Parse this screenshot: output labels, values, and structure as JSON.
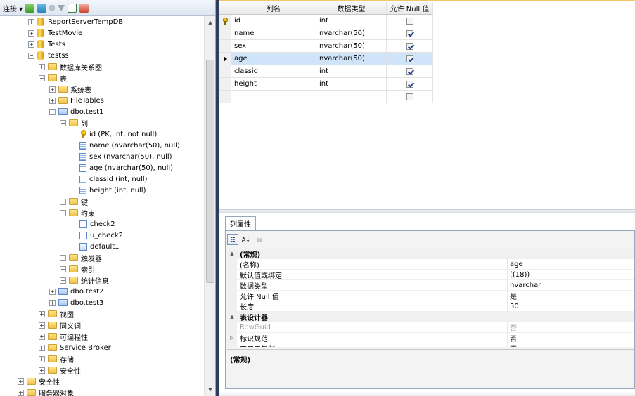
{
  "object_explorer": {
    "toolbar": {
      "connect_label": "连接 ▾"
    },
    "tree": [
      {
        "label": "ReportServerTempDB",
        "icon": "database-icon",
        "exp": "+",
        "indent": 0
      },
      {
        "label": "TestMovie",
        "icon": "database-icon",
        "exp": "+",
        "indent": 0
      },
      {
        "label": "Tests",
        "icon": "database-icon",
        "exp": "+",
        "indent": 0
      },
      {
        "label": "testss",
        "icon": "database-icon",
        "exp": "−",
        "indent": 0
      },
      {
        "label": "数据库关系图",
        "icon": "folder-icon",
        "exp": "+",
        "indent": 1
      },
      {
        "label": "表",
        "icon": "folder-icon",
        "exp": "−",
        "indent": 1
      },
      {
        "label": "系统表",
        "icon": "folder-icon",
        "exp": "+",
        "indent": 2
      },
      {
        "label": "FileTables",
        "icon": "folder-icon",
        "exp": "+",
        "indent": 2
      },
      {
        "label": "dbo.test1",
        "icon": "table-icon",
        "exp": "−",
        "indent": 2
      },
      {
        "label": "列",
        "icon": "folder-icon",
        "exp": "−",
        "indent": 3
      },
      {
        "label": "id (PK, int, not null)",
        "icon": "key-icon",
        "exp": "",
        "indent": 4
      },
      {
        "label": "name (nvarchar(50), null)",
        "icon": "column-icon",
        "exp": "",
        "indent": 4
      },
      {
        "label": "sex (nvarchar(50), null)",
        "icon": "column-icon",
        "exp": "",
        "indent": 4
      },
      {
        "label": "age (nvarchar(50), null)",
        "icon": "column-icon",
        "exp": "",
        "indent": 4
      },
      {
        "label": "classid (int, null)",
        "icon": "column-icon",
        "exp": "",
        "indent": 4
      },
      {
        "label": "height (int, null)",
        "icon": "column-icon",
        "exp": "",
        "indent": 4
      },
      {
        "label": "键",
        "icon": "folder-icon",
        "exp": "+",
        "indent": 3
      },
      {
        "label": "约束",
        "icon": "folder-icon",
        "exp": "−",
        "indent": 3
      },
      {
        "label": "check2",
        "icon": "check-constraint-icon",
        "exp": "",
        "indent": 4
      },
      {
        "label": "u_check2",
        "icon": "check-constraint-icon",
        "exp": "",
        "indent": 4
      },
      {
        "label": "default1",
        "icon": "default-constraint-icon",
        "exp": "",
        "indent": 4
      },
      {
        "label": "触发器",
        "icon": "folder-icon",
        "exp": "+",
        "indent": 3
      },
      {
        "label": "索引",
        "icon": "folder-icon",
        "exp": "+",
        "indent": 3
      },
      {
        "label": "统计信息",
        "icon": "folder-icon",
        "exp": "+",
        "indent": 3
      },
      {
        "label": "dbo.test2",
        "icon": "table-icon",
        "exp": "+",
        "indent": 2
      },
      {
        "label": "dbo.test3",
        "icon": "table-icon",
        "exp": "+",
        "indent": 2
      },
      {
        "label": "视图",
        "icon": "folder-icon",
        "exp": "+",
        "indent": 1
      },
      {
        "label": "同义词",
        "icon": "folder-icon",
        "exp": "+",
        "indent": 1
      },
      {
        "label": "可编程性",
        "icon": "folder-icon",
        "exp": "+",
        "indent": 1
      },
      {
        "label": "Service Broker",
        "icon": "folder-icon",
        "exp": "+",
        "indent": 1
      },
      {
        "label": "存储",
        "icon": "folder-icon",
        "exp": "+",
        "indent": 1
      },
      {
        "label": "安全性",
        "icon": "folder-icon",
        "exp": "+",
        "indent": 1
      },
      {
        "label": "安全性",
        "icon": "folder-icon",
        "exp": "+",
        "indent": -1
      },
      {
        "label": "服务器对象",
        "icon": "folder-icon",
        "exp": "+",
        "indent": -1
      }
    ]
  },
  "designer": {
    "headers": {
      "name": "列名",
      "type": "数据类型",
      "nullable": "允许 Null 值"
    },
    "rows": [
      {
        "name": "id",
        "type": "int",
        "nullable": false,
        "pk": true,
        "selected": false
      },
      {
        "name": "name",
        "type": "nvarchar(50)",
        "nullable": true,
        "pk": false,
        "selected": false
      },
      {
        "name": "sex",
        "type": "nvarchar(50)",
        "nullable": true,
        "pk": false,
        "selected": false
      },
      {
        "name": "age",
        "type": "nvarchar(50)",
        "nullable": true,
        "pk": false,
        "selected": true
      },
      {
        "name": "classid",
        "type": "int",
        "nullable": true,
        "pk": false,
        "selected": false
      },
      {
        "name": "height",
        "type": "int",
        "nullable": true,
        "pk": false,
        "selected": false
      },
      {
        "name": "",
        "type": "",
        "nullable": false,
        "pk": false,
        "selected": false
      }
    ]
  },
  "properties": {
    "tab_label": "列属性",
    "rows": [
      {
        "kind": "cat",
        "gut": "▲",
        "name": "(常规)",
        "value": ""
      },
      {
        "kind": "prop",
        "name": "(名称)",
        "value": "age"
      },
      {
        "kind": "prop",
        "name": "默认值或绑定",
        "value": "((18))"
      },
      {
        "kind": "prop",
        "name": "数据类型",
        "value": "nvarchar"
      },
      {
        "kind": "prop",
        "name": "允许 Null 值",
        "value": "是"
      },
      {
        "kind": "prop",
        "name": "长度",
        "value": "50"
      },
      {
        "kind": "cat",
        "gut": "▲",
        "name": "表设计器",
        "value": ""
      },
      {
        "kind": "dim",
        "name": "RowGuid",
        "value": "否"
      },
      {
        "kind": "prop",
        "gut": "▷",
        "name": "标识规范",
        "value": "否"
      },
      {
        "kind": "prop",
        "name": "不用于复制",
        "value": "否"
      }
    ],
    "description_title": "(常规)"
  }
}
